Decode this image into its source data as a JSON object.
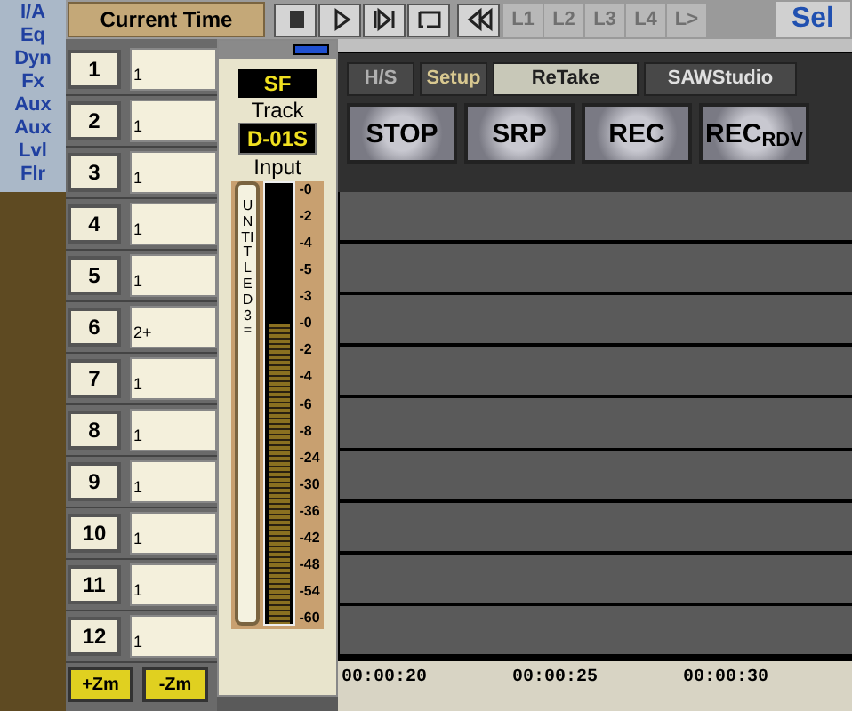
{
  "sidebar": {
    "items": [
      "I/A",
      "Eq",
      "Dyn",
      "Fx",
      "Aux",
      "Aux",
      "Lvl",
      "Flr"
    ]
  },
  "toolbar": {
    "current_time": "Current Time",
    "transport": [
      {
        "kind": "stop"
      },
      {
        "kind": "play"
      },
      {
        "kind": "next"
      },
      {
        "kind": "loop"
      },
      {
        "kind": "rewind"
      }
    ],
    "locate": [
      "L1",
      "L2",
      "L3",
      "L4",
      "L>"
    ],
    "sel": "Sel"
  },
  "tracks": [
    {
      "number": "1",
      "name": "1"
    },
    {
      "number": "2",
      "name": "1"
    },
    {
      "number": "3",
      "name": "1"
    },
    {
      "number": "4",
      "name": "1"
    },
    {
      "number": "5",
      "name": "1"
    },
    {
      "number": "6",
      "name": "2+"
    },
    {
      "number": "7",
      "name": "1"
    },
    {
      "number": "8",
      "name": "1"
    },
    {
      "number": "9",
      "name": "1"
    },
    {
      "number": "10",
      "name": "1"
    },
    {
      "number": "11",
      "name": "1"
    },
    {
      "number": "12",
      "name": "1"
    }
  ],
  "zoom_buttons": [
    "+Zm",
    "-Zm"
  ],
  "mixer": {
    "format": "SF",
    "track_label": "Track",
    "input_value": "D-01S",
    "input_label": "Input",
    "strip_name": "UNTITLED 3=",
    "meter": {
      "level": 0.68
    },
    "scale": [
      "-0",
      "-2",
      "-4",
      "-5",
      "-3",
      "-0",
      "-2",
      "-4",
      "-6",
      "-8",
      "-24",
      "-30",
      "-36",
      "-42",
      "-48",
      "-54",
      "-60"
    ]
  },
  "tabs": [
    {
      "label": "H/S",
      "selected": false
    },
    {
      "label": "Setup",
      "selected": false
    },
    {
      "label": "ReTake",
      "selected": true
    },
    {
      "label": "SAWStudio",
      "selected": false
    }
  ],
  "buttons": [
    {
      "label": "STOP"
    },
    {
      "label": "SRP"
    },
    {
      "label": "REC"
    },
    {
      "label": "REC",
      "sub": "RDV"
    }
  ],
  "ruler": [
    "00:00:20",
    "00:00:25",
    "00:00:30"
  ]
}
